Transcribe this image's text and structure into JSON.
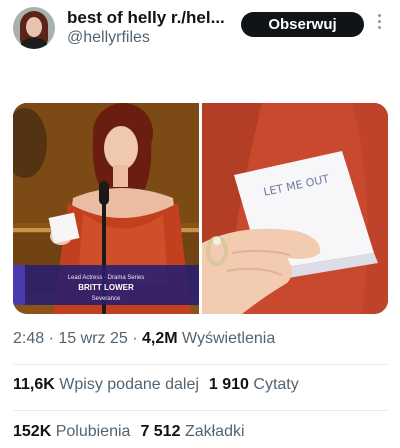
{
  "author": {
    "display_name": "best of helly r./hel...",
    "handle": "@hellyrfiles",
    "avatar_icon": "profile-photo"
  },
  "actions": {
    "follow_label": "Obserwuj",
    "more_icon": "vertical-ellipsis"
  },
  "media": {
    "left": {
      "caption_title": "Lead Actress · Drama Series",
      "caption_name": "BRITT LOWER",
      "caption_show": "Severance"
    },
    "right": {
      "note_text": "LET ME OUT"
    }
  },
  "meta": {
    "time": "2:48",
    "date": "15 wrz 25",
    "views_count": "4,2M",
    "views_label": "Wyświetlenia"
  },
  "engagement": {
    "reposts_count": "11,6K",
    "reposts_label": "Wpisy podane dalej",
    "quotes_count": "1 910",
    "quotes_label": "Cytaty",
    "likes_count": "152K",
    "likes_label": "Polubienia",
    "bookmarks_count": "7 512",
    "bookmarks_label": "Zakładki"
  },
  "colors": {
    "text_primary": "#0f1419",
    "text_secondary": "#536471",
    "button_bg": "#0f1419",
    "divider": "#e6ecf0"
  }
}
